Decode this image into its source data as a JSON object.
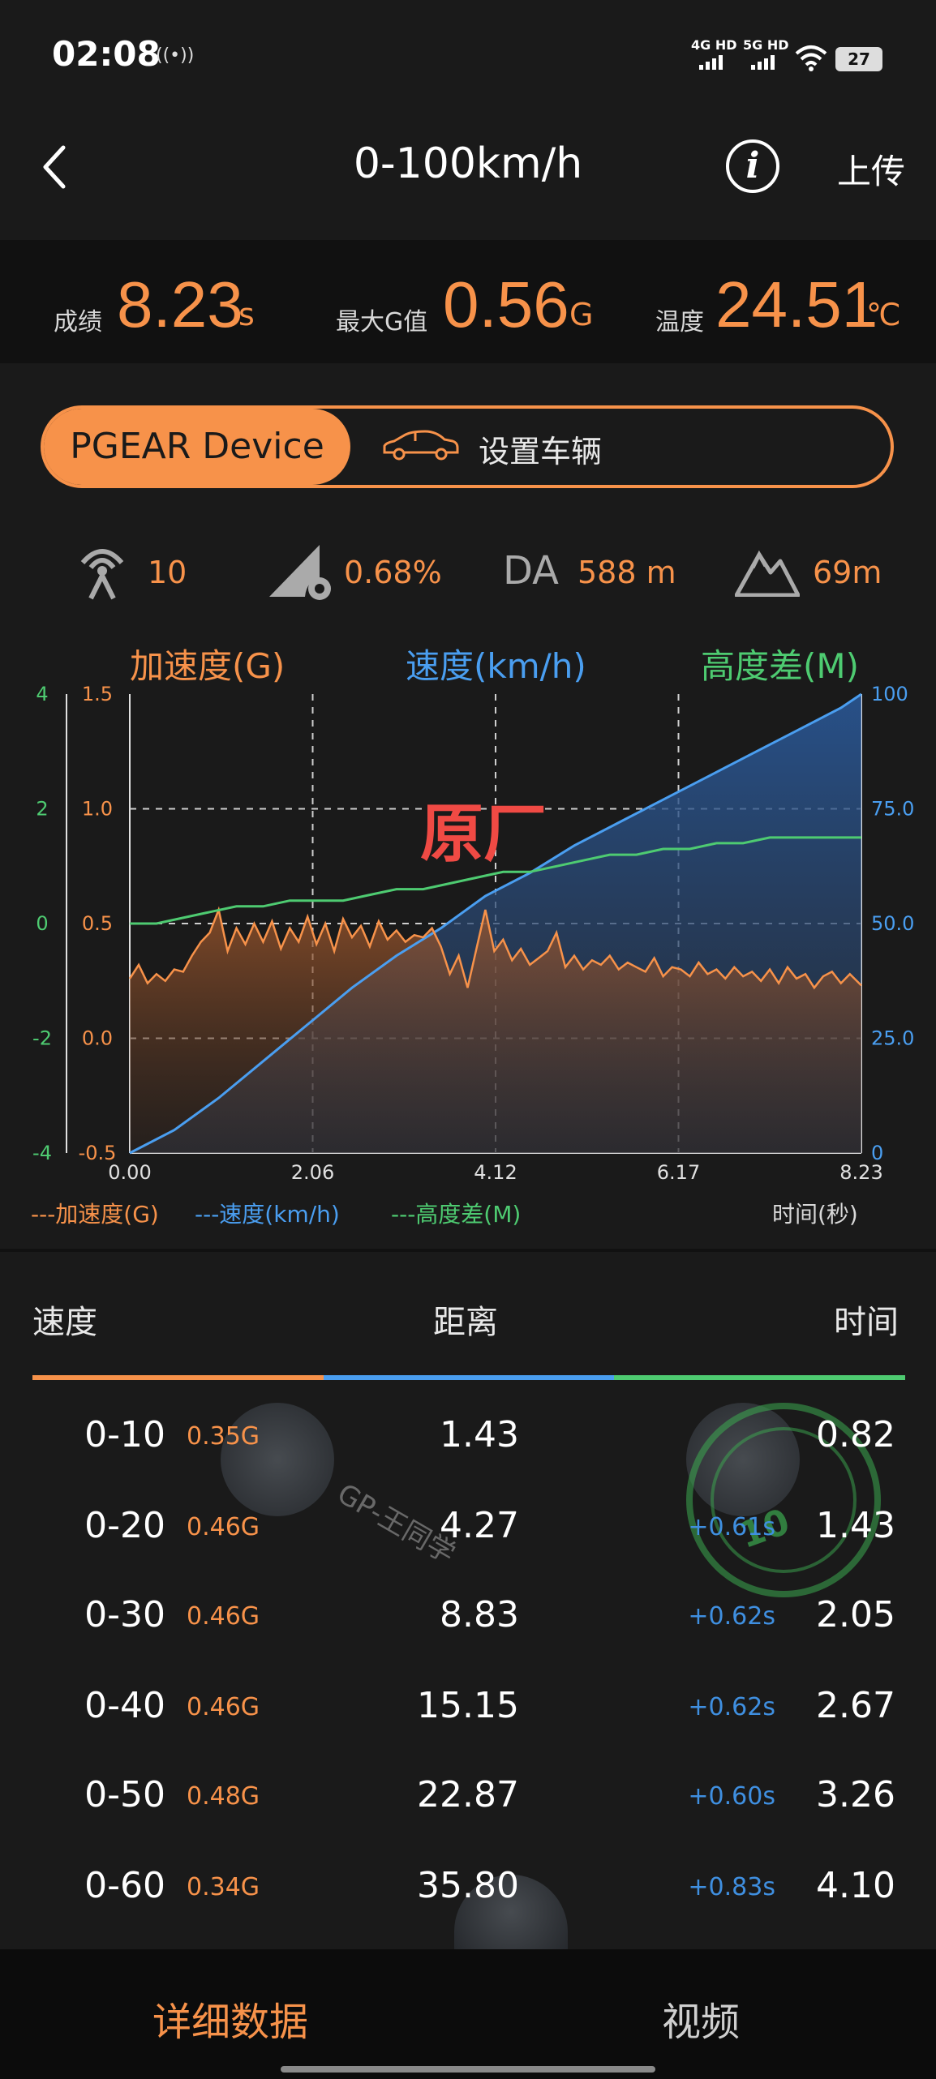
{
  "status_bar": {
    "time": "02:08",
    "net1": "4G HD",
    "net2": "5G HD",
    "battery": "27"
  },
  "header": {
    "title": "0-100km/h",
    "upload_label": "上传",
    "info_glyph": "i"
  },
  "stats": {
    "score_label": "成绩",
    "score_value": "8.23",
    "score_unit": "s",
    "maxg_label": "最大G值",
    "maxg_value": "0.56",
    "maxg_unit": "G",
    "temp_label": "温度",
    "temp_value": "24.51",
    "temp_unit": "℃"
  },
  "device": {
    "active_tab": "PGEAR Device",
    "vehicle_label": "设置车辆"
  },
  "info_row": {
    "satellites": "10",
    "slope": "0.68%",
    "da_label": "DA",
    "da_value": "588 m",
    "altitude": "69m"
  },
  "colors": {
    "accent": "#f7924a",
    "speed": "#4a9ef0",
    "height": "#4ecb71",
    "background": "#1a1a1a"
  },
  "chart_data": {
    "type": "line",
    "headings": {
      "acc": "加速度(G)",
      "speed": "速度(km/h)",
      "height": "高度差(M)"
    },
    "overlay_text": "原厂",
    "xlabel": "时间(秒)",
    "x_ticks": [
      "0.00",
      "2.06",
      "4.12",
      "6.17",
      "8.23"
    ],
    "xlim": [
      0,
      8.23
    ],
    "height_axis": {
      "ticks": [
        "4",
        "2",
        "0",
        "-2",
        "-4"
      ],
      "range": [
        -4,
        4
      ]
    },
    "acc_axis": {
      "ticks": [
        "1.5",
        "1.0",
        "0.5",
        "0.0",
        "-0.5"
      ],
      "range": [
        -0.5,
        1.5
      ]
    },
    "speed_axis": {
      "ticks": [
        "100",
        "75.0",
        "50.0",
        "25.0",
        "0"
      ],
      "range": [
        0,
        100
      ]
    },
    "grid": "dashed",
    "legend": [
      "---加速度(G)",
      "---速度(km/h)",
      "---高度差(M)"
    ],
    "series": [
      {
        "name": "加速度(G)",
        "x": [
          0.0,
          0.1,
          0.2,
          0.3,
          0.4,
          0.5,
          0.6,
          0.7,
          0.8,
          0.9,
          1.0,
          1.1,
          1.2,
          1.3,
          1.4,
          1.5,
          1.6,
          1.7,
          1.8,
          1.9,
          2.0,
          2.1,
          2.2,
          2.3,
          2.4,
          2.5,
          2.6,
          2.7,
          2.8,
          2.9,
          3.0,
          3.1,
          3.2,
          3.3,
          3.4,
          3.5,
          3.6,
          3.7,
          3.8,
          3.9,
          4.0,
          4.1,
          4.2,
          4.3,
          4.4,
          4.5,
          4.6,
          4.7,
          4.8,
          4.9,
          5.0,
          5.1,
          5.2,
          5.3,
          5.4,
          5.5,
          5.6,
          5.7,
          5.8,
          5.9,
          6.0,
          6.1,
          6.2,
          6.3,
          6.4,
          6.5,
          6.6,
          6.7,
          6.8,
          6.9,
          7.0,
          7.1,
          7.2,
          7.3,
          7.4,
          7.5,
          7.6,
          7.7,
          7.8,
          7.9,
          8.0,
          8.1,
          8.23
        ],
        "values": [
          0.26,
          0.32,
          0.24,
          0.28,
          0.25,
          0.3,
          0.29,
          0.36,
          0.42,
          0.46,
          0.56,
          0.38,
          0.48,
          0.41,
          0.5,
          0.42,
          0.51,
          0.39,
          0.48,
          0.42,
          0.53,
          0.41,
          0.5,
          0.38,
          0.52,
          0.44,
          0.49,
          0.4,
          0.51,
          0.43,
          0.47,
          0.42,
          0.45,
          0.44,
          0.48,
          0.4,
          0.28,
          0.36,
          0.22,
          0.39,
          0.56,
          0.38,
          0.43,
          0.34,
          0.39,
          0.32,
          0.35,
          0.38,
          0.46,
          0.31,
          0.36,
          0.3,
          0.34,
          0.32,
          0.36,
          0.3,
          0.33,
          0.31,
          0.29,
          0.35,
          0.27,
          0.31,
          0.3,
          0.27,
          0.33,
          0.28,
          0.3,
          0.26,
          0.31,
          0.27,
          0.29,
          0.25,
          0.3,
          0.24,
          0.31,
          0.26,
          0.28,
          0.22,
          0.27,
          0.29,
          0.24,
          0.28,
          0.23
        ]
      },
      {
        "name": "速度(km/h)",
        "x": [
          0,
          0.5,
          1,
          1.5,
          2,
          2.5,
          3,
          3.5,
          4,
          4.5,
          5,
          5.5,
          6,
          6.5,
          7,
          7.5,
          8,
          8.23
        ],
        "values": [
          0,
          5,
          12,
          20,
          28,
          36,
          43,
          49,
          56,
          61,
          67,
          72,
          77,
          82,
          87,
          92,
          97,
          100
        ]
      },
      {
        "name": "高度差(M)",
        "x": [
          0,
          0.3,
          0.6,
          0.9,
          1.2,
          1.5,
          1.8,
          2.1,
          2.4,
          2.7,
          3.0,
          3.3,
          3.6,
          3.9,
          4.2,
          4.5,
          4.8,
          5.1,
          5.4,
          5.7,
          6.0,
          6.3,
          6.6,
          6.9,
          7.2,
          7.5,
          7.8,
          8.1,
          8.23
        ],
        "values": [
          0,
          0,
          0.1,
          0.2,
          0.3,
          0.3,
          0.4,
          0.4,
          0.4,
          0.5,
          0.6,
          0.6,
          0.7,
          0.8,
          0.9,
          0.9,
          1.0,
          1.1,
          1.2,
          1.2,
          1.3,
          1.3,
          1.4,
          1.4,
          1.5,
          1.5,
          1.5,
          1.5,
          1.5
        ]
      }
    ]
  },
  "table": {
    "headers": {
      "speed": "速度",
      "distance": "距离",
      "time": "时间"
    },
    "rows": [
      {
        "range": "0-10",
        "g": "0.35G",
        "distance": "1.43",
        "delta": "",
        "time": "0.82"
      },
      {
        "range": "0-20",
        "g": "0.46G",
        "distance": "4.27",
        "delta": "+0.61s",
        "time": "1.43"
      },
      {
        "range": "0-30",
        "g": "0.46G",
        "distance": "8.83",
        "delta": "+0.62s",
        "time": "2.05"
      },
      {
        "range": "0-40",
        "g": "0.46G",
        "distance": "15.15",
        "delta": "+0.62s",
        "time": "2.67"
      },
      {
        "range": "0-50",
        "g": "0.48G",
        "distance": "22.87",
        "delta": "+0.60s",
        "time": "3.26"
      },
      {
        "range": "0-60",
        "g": "0.34G",
        "distance": "35.80",
        "delta": "+0.83s",
        "time": "4.10"
      }
    ]
  },
  "watermark": {
    "text": "GP-王同学",
    "stamp": "10"
  },
  "bottom_nav": {
    "tab_details": "详细数据",
    "tab_video": "视频"
  }
}
